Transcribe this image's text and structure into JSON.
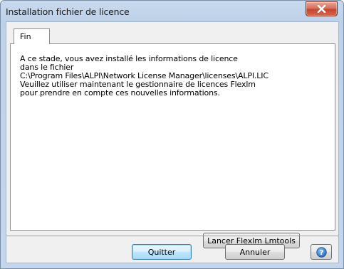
{
  "window": {
    "title": "Installation fichier de licence"
  },
  "tabs": [
    {
      "label": "Fin",
      "selected": true
    }
  ],
  "message": {
    "lines": [
      "A ce stade, vous avez installé les informations de licence",
      "dans le fichier",
      "C:\\Program Files\\ALPI\\Network License Manager\\licenses\\ALPI.LIC",
      "Veuillez utiliser maintenant le gestionnaire de licences Flexlm",
      "pour prendre en compte ces nouvelles informations."
    ]
  },
  "buttons": {
    "lmtools": "Lancer Flexlm Lmtools",
    "quit": "Quitter",
    "cancel": "Annuler"
  },
  "icons": {
    "close": "close-icon",
    "help": "help-icon"
  },
  "colors": {
    "close_button": "#c64331",
    "default_button_border": "#3c7fb1",
    "help_icon": "#2a6ab8"
  }
}
